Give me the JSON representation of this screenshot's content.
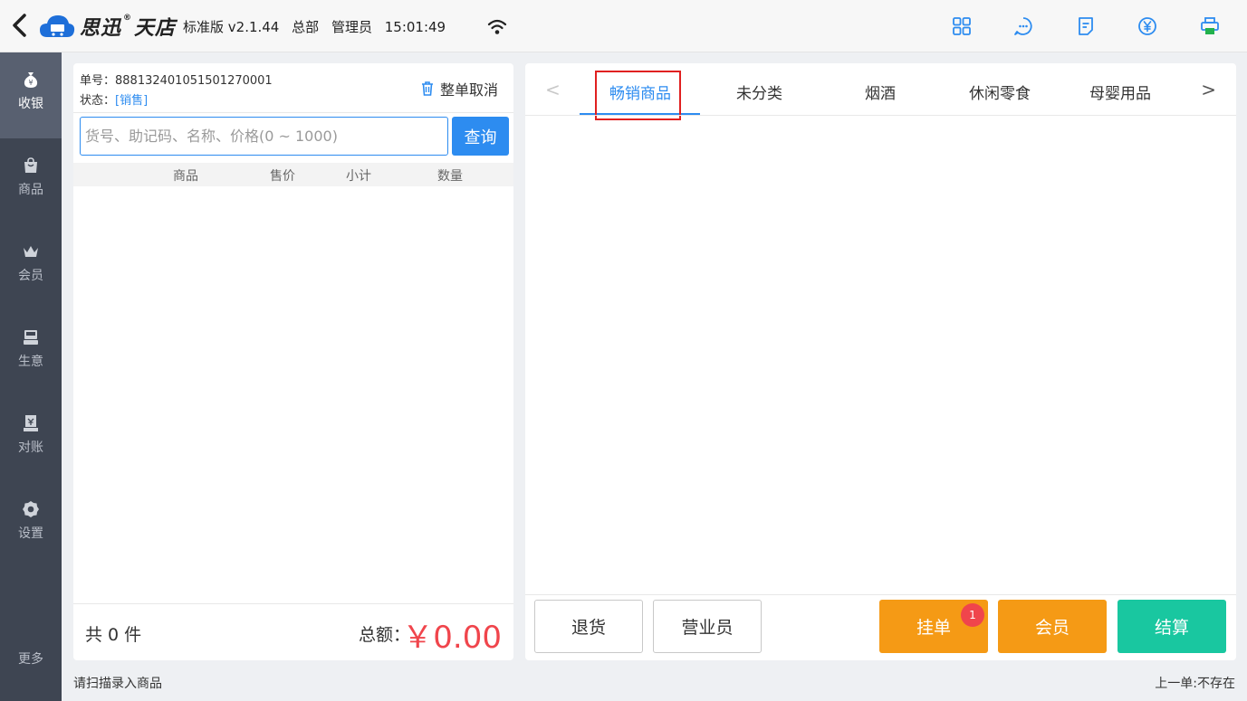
{
  "header": {
    "brand": "思迅",
    "brand_mark": "®",
    "brand_name": "天店",
    "edition": "标准版 v2.1.44",
    "branch": "总部",
    "user": "管理员",
    "time": "15:01:49"
  },
  "sidebar": {
    "items": [
      {
        "label": "收银",
        "icon": "money-bag-icon"
      },
      {
        "label": "商品",
        "icon": "shopping-bag-icon"
      },
      {
        "label": "会员",
        "icon": "crown-icon"
      },
      {
        "label": "生意",
        "icon": "register-icon"
      },
      {
        "label": "对账",
        "icon": "ledger-icon"
      },
      {
        "label": "设置",
        "icon": "gear-icon"
      }
    ],
    "more_label": "更多"
  },
  "order": {
    "number_label": "单号：",
    "number_value": "888132401051501270001",
    "status_label": "状态：",
    "status_value": "[销售]",
    "cancel_label": "整单取消"
  },
  "search": {
    "placeholder": "货号、助记码、名称、价格(0 ~ 1000)",
    "button_label": "查询"
  },
  "table": {
    "columns": [
      "商品",
      "售价",
      "小计",
      "数量"
    ],
    "rows": []
  },
  "totals": {
    "count_text": "共 0 件",
    "total_label": "总额：",
    "total_value": "￥0.00"
  },
  "category_tabs": {
    "items": [
      "畅销商品",
      "未分类",
      "烟酒",
      "休闲零食",
      "母婴用品"
    ],
    "active_index": 0,
    "prev_glyph": "<",
    "next_glyph": ">"
  },
  "actions": {
    "return_label": "退货",
    "clerk_label": "营业员",
    "hold_label": "挂单",
    "hold_badge": "1",
    "member_label": "会员",
    "checkout_label": "结算"
  },
  "status_bar": {
    "hint": "请扫描录入商品",
    "last_order": "上一单:不存在"
  },
  "colors": {
    "accent": "#2d8cf0",
    "orange": "#f59a15",
    "green": "#19c7a0",
    "red": "#f0454c",
    "sidebar": "#3e4552"
  }
}
